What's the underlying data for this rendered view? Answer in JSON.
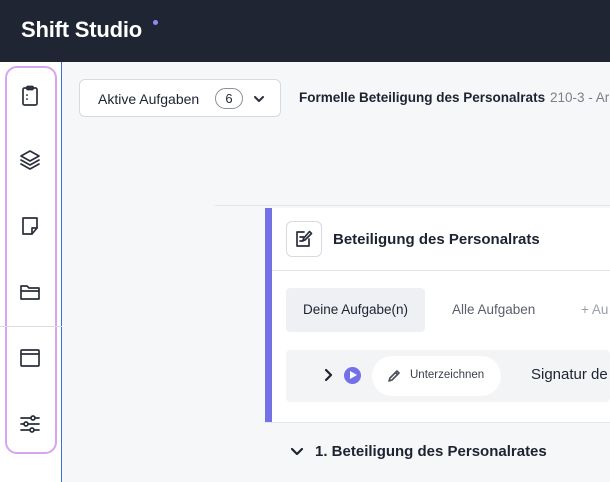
{
  "header": {
    "app_name": "Shift Studio",
    "accent": "#8b8df5",
    "background": "#1f2533"
  },
  "sidebar": {
    "highlight_color": "#d8a3f0",
    "items": [
      {
        "id": "tasks",
        "icon": "clipboard-icon"
      },
      {
        "id": "layers",
        "icon": "layers-icon"
      },
      {
        "id": "notes",
        "icon": "sticky-note-icon"
      },
      {
        "id": "files",
        "icon": "folder-icon"
      },
      {
        "id": "window",
        "icon": "window-icon"
      },
      {
        "id": "settings",
        "icon": "sliders-icon"
      }
    ]
  },
  "toolbar": {
    "task_filter_label": "Aktive Aufgaben",
    "task_filter_count": "6",
    "breadcrumb_title": "Formelle Beteiligung des Personalrats",
    "breadcrumb_sub": "210-3 - Ar"
  },
  "panel": {
    "accent": "#7470e6",
    "title": "Beteiligung des Personalrats",
    "tabs": [
      {
        "label": "Deine Aufgabe(n)",
        "active": true
      },
      {
        "label": "Alle Aufgaben",
        "active": false
      },
      {
        "label": "+ Au",
        "active": false
      }
    ],
    "task_row": {
      "action_label": "Unterzeichnen",
      "title": "Signatur de"
    }
  },
  "section": {
    "title": "1. Beteiligung des Personalrates"
  }
}
